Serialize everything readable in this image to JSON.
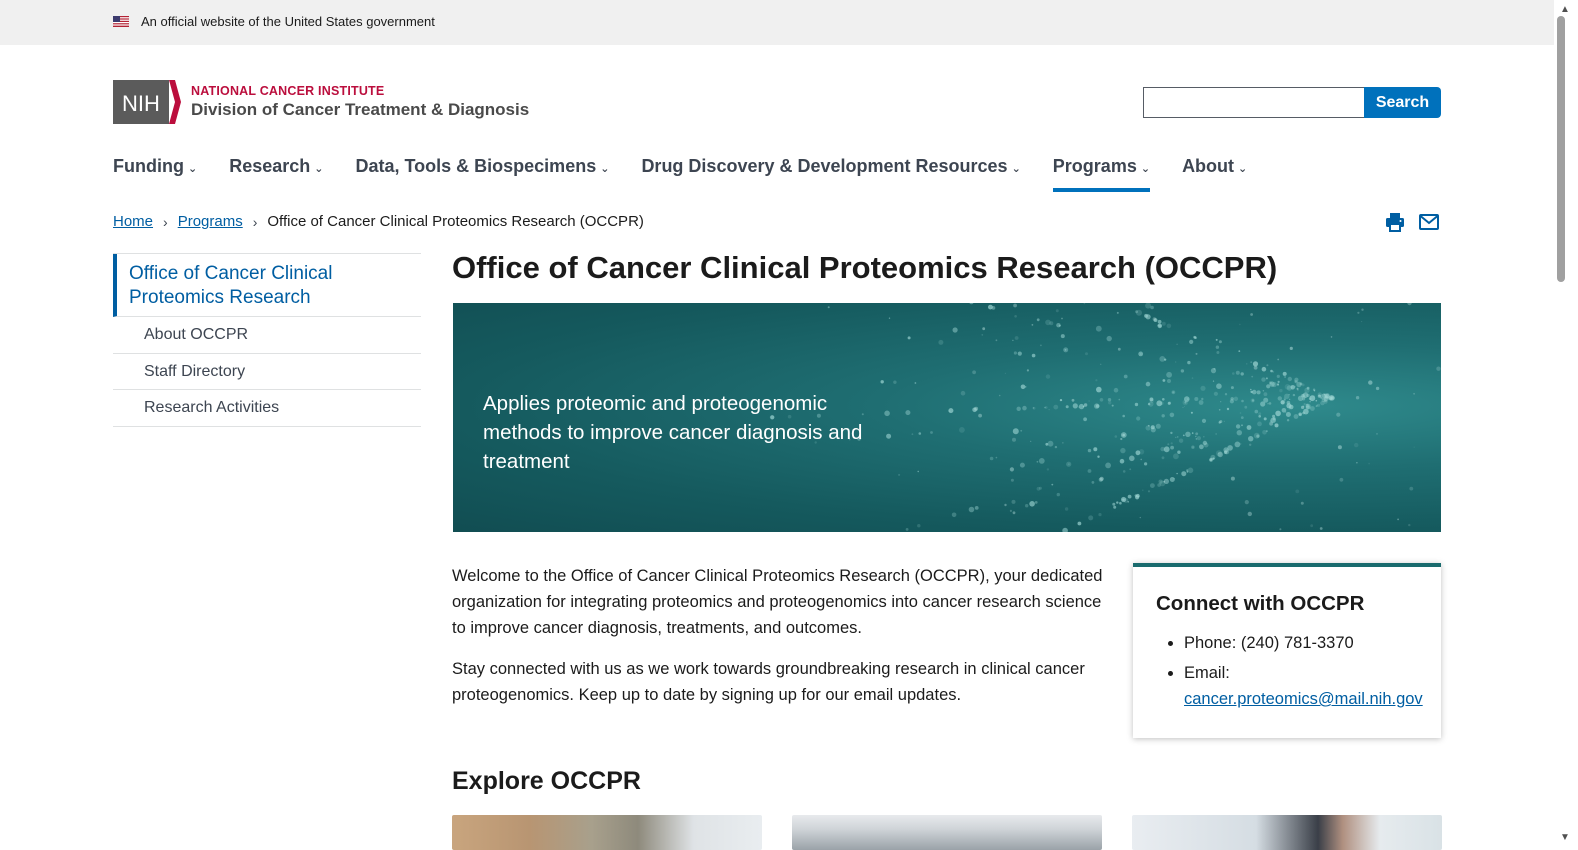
{
  "gov_banner": {
    "text": "An official website of the United States government",
    "flag_icon": "us-flag-icon"
  },
  "header": {
    "logo_mark": "NIH",
    "logo_org": "NATIONAL CANCER INSTITUTE",
    "logo_division": "Division of Cancer Treatment & Diagnosis",
    "search_value": "",
    "search_button": "Search"
  },
  "nav": {
    "items": [
      {
        "label": "Funding"
      },
      {
        "label": "Research"
      },
      {
        "label": "Data, Tools & Biospecimens"
      },
      {
        "label": "Drug Discovery & Development Resources"
      },
      {
        "label": "Programs",
        "active": true
      },
      {
        "label": "About"
      }
    ]
  },
  "breadcrumb": {
    "home": "Home",
    "programs": "Programs",
    "current": "Office of Cancer Clinical Proteomics Research (OCCPR)",
    "separator": "›"
  },
  "sidenav": {
    "parent": "Office of Cancer Clinical Proteomics Research",
    "children": [
      "About OCCPR",
      "Staff Directory",
      "Research Activities"
    ]
  },
  "main": {
    "title": "Office of Cancer Clinical Proteomics Research (OCCPR)",
    "hero_text": "Applies proteomic and proteogenomic methods to improve cancer diagnosis and treatment",
    "intro_p1": "Welcome to the Office of Cancer Clinical Proteomics Research (OCCPR), your dedicated organization for integrating proteomics and proteogenomics into cancer research science to improve cancer diagnosis, treatments, and outcomes.",
    "intro_p2": "Stay connected with us as we work towards groundbreaking research in clinical cancer proteogenomics. Keep up to date by signing up for our email updates.",
    "explore_heading": "Explore OCCPR"
  },
  "connect": {
    "heading": "Connect with OCCPR",
    "phone": "Phone: (240) 781-3370",
    "email_label": "Email:",
    "email": "cancer.proteomics@mail.nih.gov"
  },
  "colors": {
    "primary": "#005ea2",
    "nci_red": "#bb0e3d",
    "hero_teal": "#1a6b6e",
    "search_blue": "#0071bc"
  }
}
